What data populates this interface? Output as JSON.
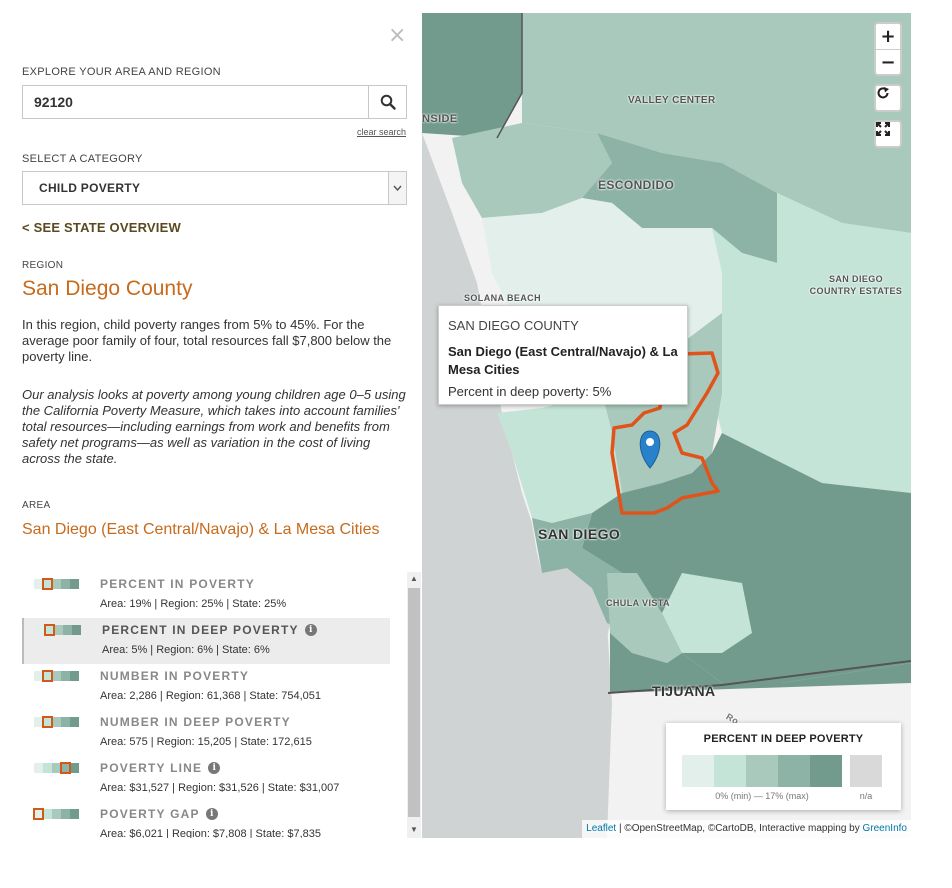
{
  "panel": {
    "close_glyph": "×",
    "explore_label": "EXPLORE YOUR AREA AND REGION",
    "search_value": "92120",
    "clear_search": "clear search",
    "category_label": "SELECT A CATEGORY",
    "category_value": "CHILD POVERTY",
    "state_overview_link": "< SEE STATE OVERVIEW",
    "region_label": "REGION",
    "region_name": "San Diego County",
    "region_description": "In this region, child poverty ranges from 5% to 45%. For the average poor family of four, total resources fall $7,800 below the poverty line.",
    "analysis_note": "Our analysis looks at poverty among young children age 0–5 using the California Poverty Measure, which takes into account families' total resources—including earnings from work and benefits from safety net programs—as well as variation in the cost of living across the state.",
    "area_label": "AREA",
    "area_name": "San Diego (East Central/Navajo) & La Mesa Cities"
  },
  "stats": [
    {
      "name": "PERCENT IN POVERTY",
      "values": "Area: 19% | Region: 25% | State: 25%",
      "info": false,
      "active": false,
      "bin": 1
    },
    {
      "name": "PERCENT IN DEEP POVERTY",
      "values": "Area: 5% | Region: 6% | State: 6%",
      "info": true,
      "active": true,
      "bin": 1
    },
    {
      "name": "NUMBER IN POVERTY",
      "values": "Area: 2,286 | Region: 61,368 | State: 754,051",
      "info": false,
      "active": false,
      "bin": 1
    },
    {
      "name": "NUMBER IN DEEP POVERTY",
      "values": "Area: 575 | Region: 15,205 | State: 172,615",
      "info": false,
      "active": false,
      "bin": 1
    },
    {
      "name": "POVERTY LINE",
      "values": "Area: $31,527 | Region: $31,526 | State: $31,007",
      "info": true,
      "active": false,
      "bin": 3
    },
    {
      "name": "POVERTY GAP",
      "values": "Area: $6,021 | Region: $7,808 | State: $7,835",
      "info": true,
      "active": false,
      "bin": 0
    }
  ],
  "map": {
    "places": {
      "valley_center": "VALLEY CENTER",
      "oceanside": "NSIDE",
      "escondido": "ESCONDIDO",
      "san_diego_country_estates": "SAN DIEGO COUNTRY ESTATES",
      "solana_beach": "SOLANA BEACH",
      "san_diego": "SAN DIEGO",
      "chula_vista": "CHULA VISTA",
      "tijuana": "TIJUANA",
      "road_fragment": "Ro"
    },
    "zoom_in": "+",
    "zoom_out": "−",
    "popup": {
      "region": "SAN DIEGO COUNTY",
      "area": "San Diego (East Central/Navajo) & La Mesa Cities",
      "value": "Percent in deep poverty: 5%"
    },
    "legend": {
      "title": "PERCENT IN DEEP POVERTY",
      "range": "0% (min) — 17% (max)",
      "na": "n/a",
      "colors": [
        "#e3efeb",
        "#c4e4d8",
        "#a8c9bc",
        "#8cb3a5",
        "#729b8e"
      ],
      "na_color": "#d9d9d9"
    },
    "attribution": {
      "leaflet": "Leaflet",
      "middle": " | ©OpenStreetMap, ©CartoDB, Interactive mapping by ",
      "greeninfo": "GreenInfo"
    },
    "highlight_color": "#e0541c"
  }
}
